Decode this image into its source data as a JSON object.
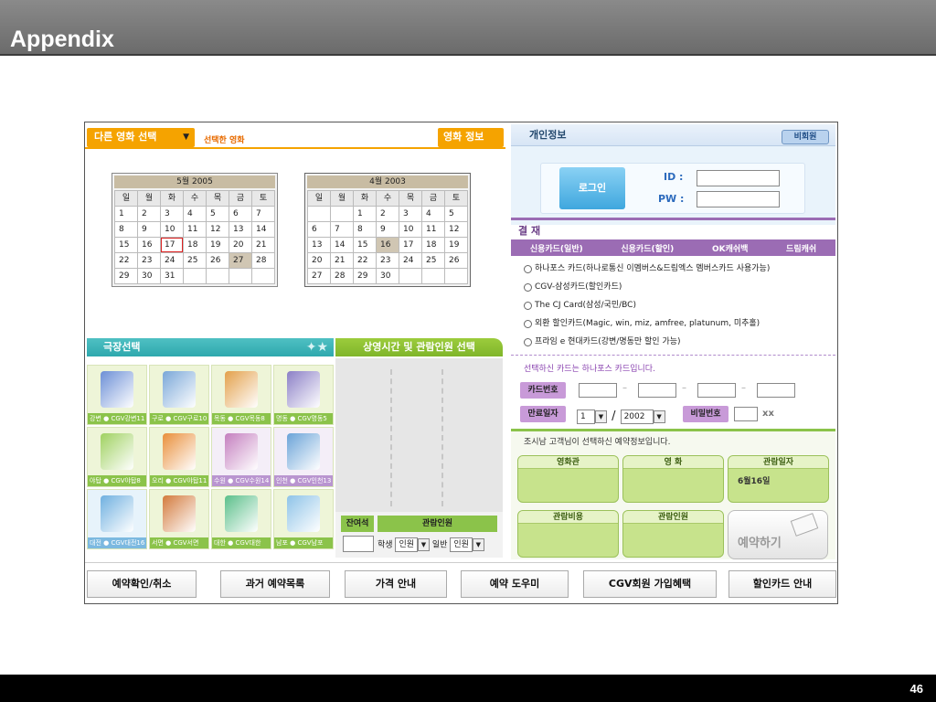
{
  "slide": {
    "title": "Appendix",
    "page_number": "46"
  },
  "left": {
    "other_movie_tab": "다른 영화 선택",
    "other_movie_arrow": "▼",
    "selected_movie_label": "선택한 영화",
    "movie_info_tab": "영화 정보",
    "calendars": [
      {
        "title": "5월  2005",
        "weekdays": [
          "일",
          "월",
          "화",
          "수",
          "목",
          "금",
          "토"
        ],
        "days": [
          "1",
          "2",
          "3",
          "4",
          "5",
          "6",
          "7",
          "8",
          "9",
          "10",
          "11",
          "12",
          "13",
          "14",
          "15",
          "16",
          "17",
          "18",
          "19",
          "20",
          "21",
          "22",
          "23",
          "24",
          "25",
          "26",
          "27",
          "28",
          "29",
          "30",
          "31",
          "",
          "",
          "",
          ""
        ],
        "selected": "17",
        "highlighted": "27"
      },
      {
        "title": "4월  2003",
        "weekdays": [
          "일",
          "월",
          "화",
          "수",
          "목",
          "금",
          "토"
        ],
        "days": [
          "",
          "",
          "1",
          "2",
          "3",
          "4",
          "5",
          "6",
          "7",
          "8",
          "9",
          "10",
          "11",
          "12",
          "13",
          "14",
          "15",
          "16",
          "17",
          "18",
          "19",
          "20",
          "21",
          "22",
          "23",
          "24",
          "25",
          "26",
          "27",
          "28",
          "29",
          "30",
          "",
          "",
          ""
        ],
        "selected": "",
        "highlighted": "16"
      }
    ],
    "theater_select_title": "극장선택",
    "theaters": [
      {
        "label": "강변 ● CGV강변11",
        "color": "green"
      },
      {
        "label": "구로 ● CGV구로10",
        "color": "green"
      },
      {
        "label": "목동 ● CGV목동8",
        "color": "green"
      },
      {
        "label": "명동 ● CGV명동5",
        "color": "green"
      },
      {
        "label": "야탑 ● CGV야탑8",
        "color": "green"
      },
      {
        "label": "오리 ● CGV야탑11",
        "color": "green"
      },
      {
        "label": "수원 ● CGV수원14",
        "color": "purple"
      },
      {
        "label": "인천 ● CGV인천13",
        "color": "purple"
      },
      {
        "label": "대전 ● CGV대전16",
        "color": "blue"
      },
      {
        "label": "서면 ● CGV서면",
        "color": "green"
      },
      {
        "label": "대한 ● CGV대한",
        "color": "green"
      },
      {
        "label": "남포 ● CGV남포",
        "color": "green"
      }
    ],
    "showtime_title": "상영시간 및 관람인원 선택",
    "remaining_seats": "잔여석",
    "audience_label": "관람인원",
    "student_label": "학생",
    "general_label": "일반",
    "people_unit": "인원",
    "arrow": "▼"
  },
  "right": {
    "personal_info_title": "개인정보",
    "non_member_button": "비회원",
    "login_button": "로그인",
    "id_label": "ID :",
    "pw_label": "PW :",
    "payment_title": "결 재",
    "payment_tabs": [
      "신용카드(일반)",
      "신용카드(할인)",
      "OK캐쉬백",
      "드림캐쉬"
    ],
    "card_options": [
      "하나포스 카드(하나로통신 이멤버스&드림엑스 멤버스카드 사용가능)",
      "CGV-삼성카드(할인카드)",
      "The CJ Card(삼성/국민/BC)",
      "외환 할인카드(Magic, win, miz, amfree, platunum, 미추홀)",
      "프라임 e 현대카드(강변/명동만 할인 가능)"
    ],
    "selected_card_msg": "선택하신 카드는 하나포스 카드입니다.",
    "card_number_label": "카드번호",
    "expiry_label": "만료일자",
    "expiry_month": "1",
    "expiry_year": "2002",
    "password_label": "비밀번호",
    "password_suffix": "xx",
    "summary_msg": "조시남  고객님이 선택하신 예약정보입니다.",
    "boxes": [
      {
        "head": "영화관",
        "value": ""
      },
      {
        "head": "영 화",
        "value": ""
      },
      {
        "head": "관람일자",
        "value": "6월16일"
      },
      {
        "head": "관람비용",
        "value": ""
      },
      {
        "head": "관람인원",
        "value": ""
      }
    ],
    "reserve_button": "예약하기"
  },
  "bottom_nav": [
    "예약확인/취소",
    "과거 예약목록",
    "가격 안내",
    "예약 도우미",
    "CGV회원 가입혜택",
    "할인카드 안내"
  ]
}
